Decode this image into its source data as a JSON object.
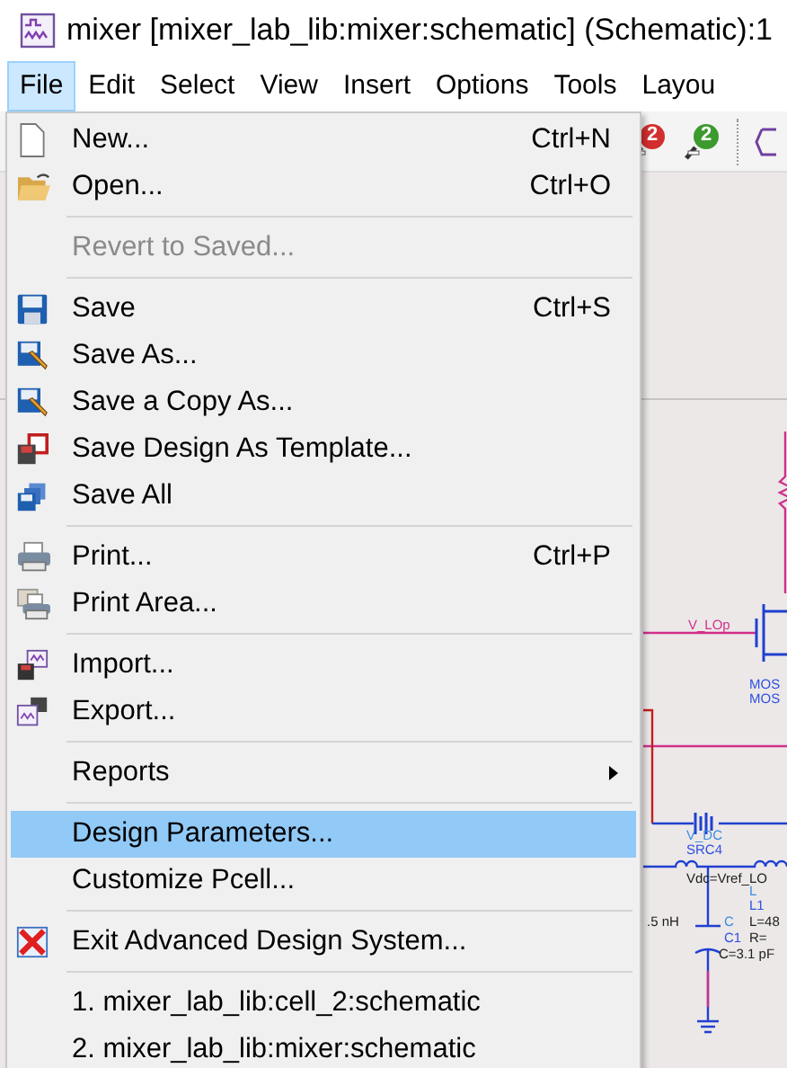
{
  "window": {
    "title": "mixer [mixer_lab_lib:mixer:schematic] (Schematic):1"
  },
  "menubar": [
    {
      "label": "File",
      "selected": true
    },
    {
      "label": "Edit",
      "selected": false
    },
    {
      "label": "Select",
      "selected": false
    },
    {
      "label": "View",
      "selected": false
    },
    {
      "label": "Insert",
      "selected": false
    },
    {
      "label": "Options",
      "selected": false
    },
    {
      "label": "Tools",
      "selected": false
    },
    {
      "label": "Layou",
      "selected": false
    }
  ],
  "toolbar": [
    {
      "badge": "2",
      "color": "#d32f2f"
    },
    {
      "badge": "2",
      "color": "#3c9a2e"
    }
  ],
  "file_menu": [
    {
      "kind": "item",
      "label": "New...",
      "shortcut": "Ctrl+N",
      "disabled": false,
      "selected": false
    },
    {
      "kind": "item",
      "label": "Open...",
      "shortcut": "Ctrl+O",
      "disabled": false,
      "selected": false
    },
    {
      "kind": "separator"
    },
    {
      "kind": "item",
      "label": "Revert to Saved...",
      "disabled": true,
      "selected": false
    },
    {
      "kind": "separator"
    },
    {
      "kind": "item",
      "label": "Save",
      "shortcut": "Ctrl+S",
      "disabled": false,
      "selected": false
    },
    {
      "kind": "item",
      "label": "Save As...",
      "disabled": false,
      "selected": false
    },
    {
      "kind": "item",
      "label": "Save a Copy As...",
      "disabled": false,
      "selected": false
    },
    {
      "kind": "item",
      "label": "Save Design As Template...",
      "disabled": false,
      "selected": false
    },
    {
      "kind": "item",
      "label": "Save All",
      "disabled": false,
      "selected": false
    },
    {
      "kind": "separator"
    },
    {
      "kind": "item",
      "label": "Print...",
      "shortcut": "Ctrl+P",
      "disabled": false,
      "selected": false
    },
    {
      "kind": "item",
      "label": "Print Area...",
      "disabled": false,
      "selected": false
    },
    {
      "kind": "separator"
    },
    {
      "kind": "item",
      "label": "Import...",
      "disabled": false,
      "selected": false
    },
    {
      "kind": "item",
      "label": "Export...",
      "disabled": false,
      "selected": false
    },
    {
      "kind": "separator"
    },
    {
      "kind": "item",
      "label": "Reports",
      "submenu": true,
      "disabled": false,
      "selected": false
    },
    {
      "kind": "separator"
    },
    {
      "kind": "item",
      "label": "Design Parameters...",
      "disabled": false,
      "selected": true
    },
    {
      "kind": "item",
      "label": "Customize Pcell...",
      "disabled": false,
      "selected": false
    },
    {
      "kind": "separator"
    },
    {
      "kind": "item",
      "label": "Exit Advanced Design System...",
      "disabled": false,
      "selected": false
    },
    {
      "kind": "separator"
    },
    {
      "kind": "item",
      "label": "1. mixer_lab_lib:cell_2:schematic",
      "disabled": false,
      "selected": false
    },
    {
      "kind": "item",
      "label": "2. mixer_lab_lib:mixer:schematic",
      "disabled": false,
      "selected": false
    }
  ],
  "schematic": {
    "labels": [
      {
        "text": "V_LOp",
        "color": "#d0308a"
      },
      {
        "text": "MOS",
        "color": "#3050e0"
      },
      {
        "text": "MOS",
        "color": "#3050e0"
      },
      {
        "text": "V_DC",
        "color": "#3a8ee0"
      },
      {
        "text": "SRC4",
        "color": "#3050e0"
      },
      {
        "text": "Vdc=Vref_LO",
        "color": "#202020"
      },
      {
        "text": "L",
        "color": "#3a8ee0"
      },
      {
        "text": "L1",
        "color": "#3050e0"
      },
      {
        "text": ".5 nH",
        "color": "#202020"
      },
      {
        "text": "C",
        "color": "#3a8ee0"
      },
      {
        "text": "L=48",
        "color": "#202020"
      },
      {
        "text": "C1",
        "color": "#3050e0"
      },
      {
        "text": "R=",
        "color": "#202020"
      },
      {
        "text": "C=3.1 pF",
        "color": "#202020"
      }
    ]
  }
}
